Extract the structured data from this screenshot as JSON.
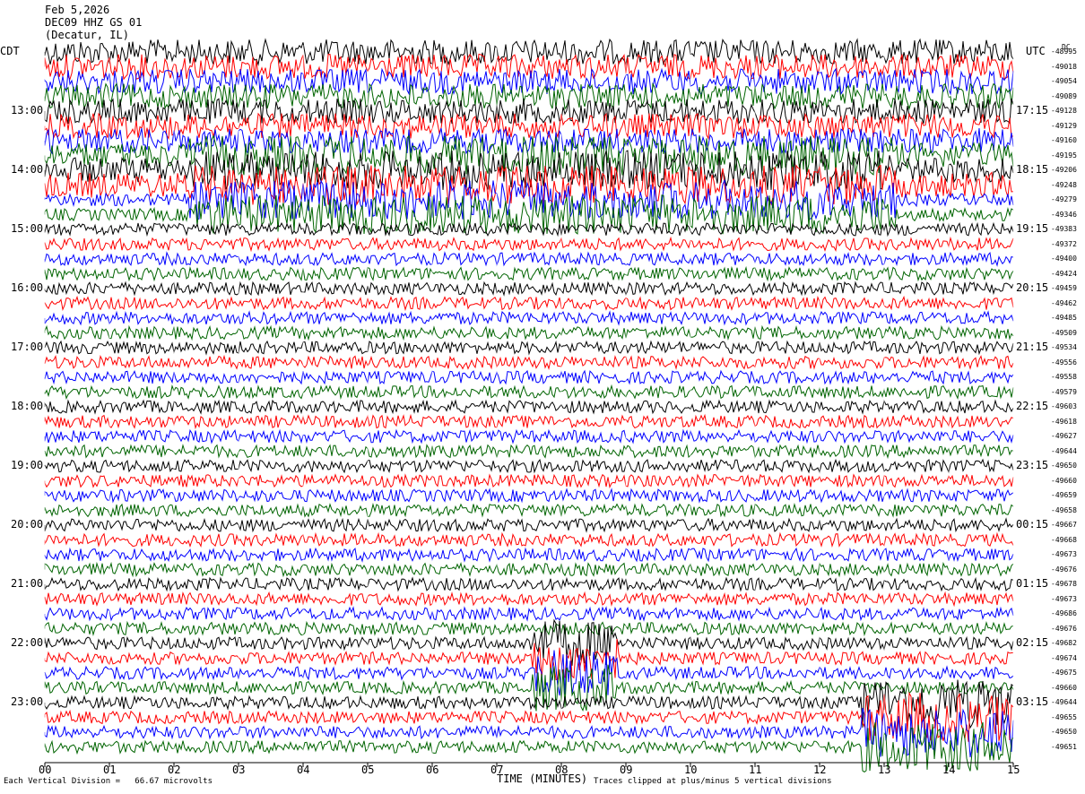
{
  "header": {
    "date": "Feb 5,2026",
    "station": "DEC09 HHZ GS 01",
    "subtitle": "(Decatur, IL)"
  },
  "chart_data": {
    "type": "line",
    "title": "Feb 5,2026",
    "xlabel": "TIME (MINUTES)",
    "x_ticks": [
      "00",
      "01",
      "02",
      "03",
      "04",
      "05",
      "06",
      "07",
      "08",
      "09",
      "10",
      "11",
      "12",
      "13",
      "14",
      "15"
    ],
    "xlim": [
      0,
      15
    ],
    "left_axis_label": "CDT",
    "right_axis_label": "UTC",
    "dc_label": "DC",
    "left_hour_labels": [
      "13:00",
      "14:00",
      "15:00",
      "16:00",
      "17:00",
      "18:00",
      "19:00",
      "20:00",
      "21:00",
      "22:00",
      "23:00"
    ],
    "right_hour_labels": [
      "17:15",
      "18:15",
      "19:15",
      "20:15",
      "21:15",
      "22:15",
      "23:15",
      "00:15",
      "01:15",
      "02:15",
      "03:15"
    ],
    "trace_colors": [
      "#000000",
      "#ff0000",
      "#0000ff",
      "#006400"
    ],
    "dc_offsets": [
      "-48995",
      "-49018",
      "-49054",
      "-49089",
      "-49128",
      "-49129",
      "-49160",
      "-49195",
      "-49206",
      "-49248",
      "-49279",
      "-49346",
      "-49383",
      "-49372",
      "-49400",
      "-49424",
      "-49459",
      "-49462",
      "-49485",
      "-49509",
      "-49534",
      "-49556",
      "-49558",
      "-49579",
      "-49603",
      "-49618",
      "-49627",
      "-49644",
      "-49650",
      "-49660",
      "-49659",
      "-49658",
      "-49667",
      "-49668",
      "-49673",
      "-49676",
      "-49678",
      "-49673",
      "-49686",
      "-49676",
      "-49682",
      "-49674",
      "-49675",
      "-49660",
      "-49644",
      "-49655",
      "-49650",
      "-49651"
    ],
    "scale_text": "Each Vertical Division =   66.67 microvolts",
    "clip_text": "Traces clipped at plus/minus 5 vertical divisions"
  }
}
